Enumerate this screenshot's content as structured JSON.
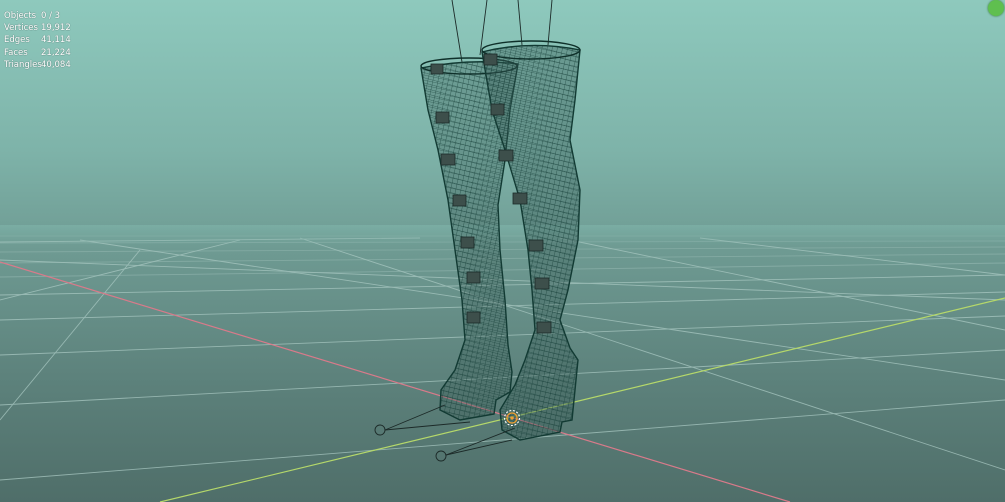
{
  "viewport": {
    "background_top": "#8ec9bd",
    "background_bottom": "#4f6e69",
    "x_axis_color": "#d97a8a",
    "y_axis_color": "#b5d86a",
    "grid_color": "#a9c8c2",
    "wire_color": "#123a33",
    "origin_color": "#f0a030"
  },
  "stats": [
    {
      "label": "Objects",
      "value": "0 / 3"
    },
    {
      "label": "Vertices",
      "value": "19,912"
    },
    {
      "label": "Edges",
      "value": "41,114"
    },
    {
      "label": "Faces",
      "value": "21,224"
    },
    {
      "label": "Triangles",
      "value": "40,084"
    }
  ],
  "gizmo_icon": "navigation-gizmo-icon"
}
